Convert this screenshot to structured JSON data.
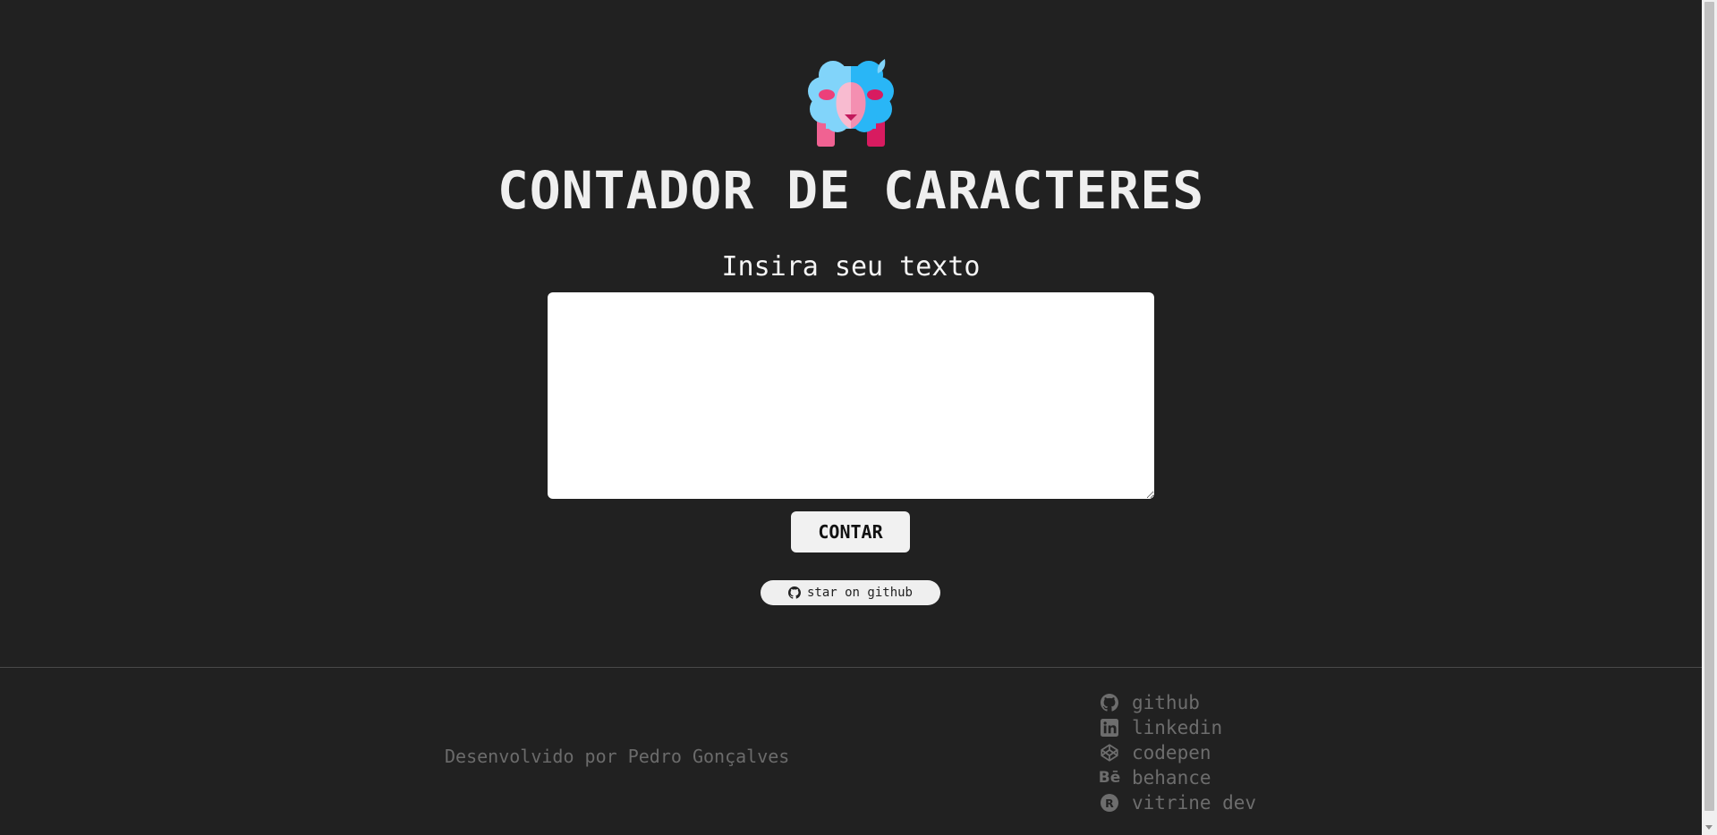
{
  "header": {
    "logo_icon": "sheep-icon",
    "title": "CONTADOR DE CARACTERES"
  },
  "form": {
    "label": "Insira seu texto",
    "textarea_value": "",
    "submit_label": "CONTAR"
  },
  "star_badge": {
    "icon": "github-icon",
    "label": "star on github"
  },
  "footer": {
    "credit": "Desenvolvido por Pedro Gonçalves",
    "links": [
      {
        "icon": "github-icon",
        "label": "github"
      },
      {
        "icon": "linkedin-icon",
        "label": "linkedin"
      },
      {
        "icon": "codepen-icon",
        "label": "codepen"
      },
      {
        "icon": "behance-icon",
        "label": "behance"
      },
      {
        "icon": "vitrine-icon",
        "label": "vitrine dev"
      }
    ]
  },
  "colors": {
    "background": "#212121",
    "text": "#efefef",
    "muted": "#6d6d6d",
    "sheep_blue": "#29b6f6",
    "sheep_pink": "#f48fb1"
  }
}
